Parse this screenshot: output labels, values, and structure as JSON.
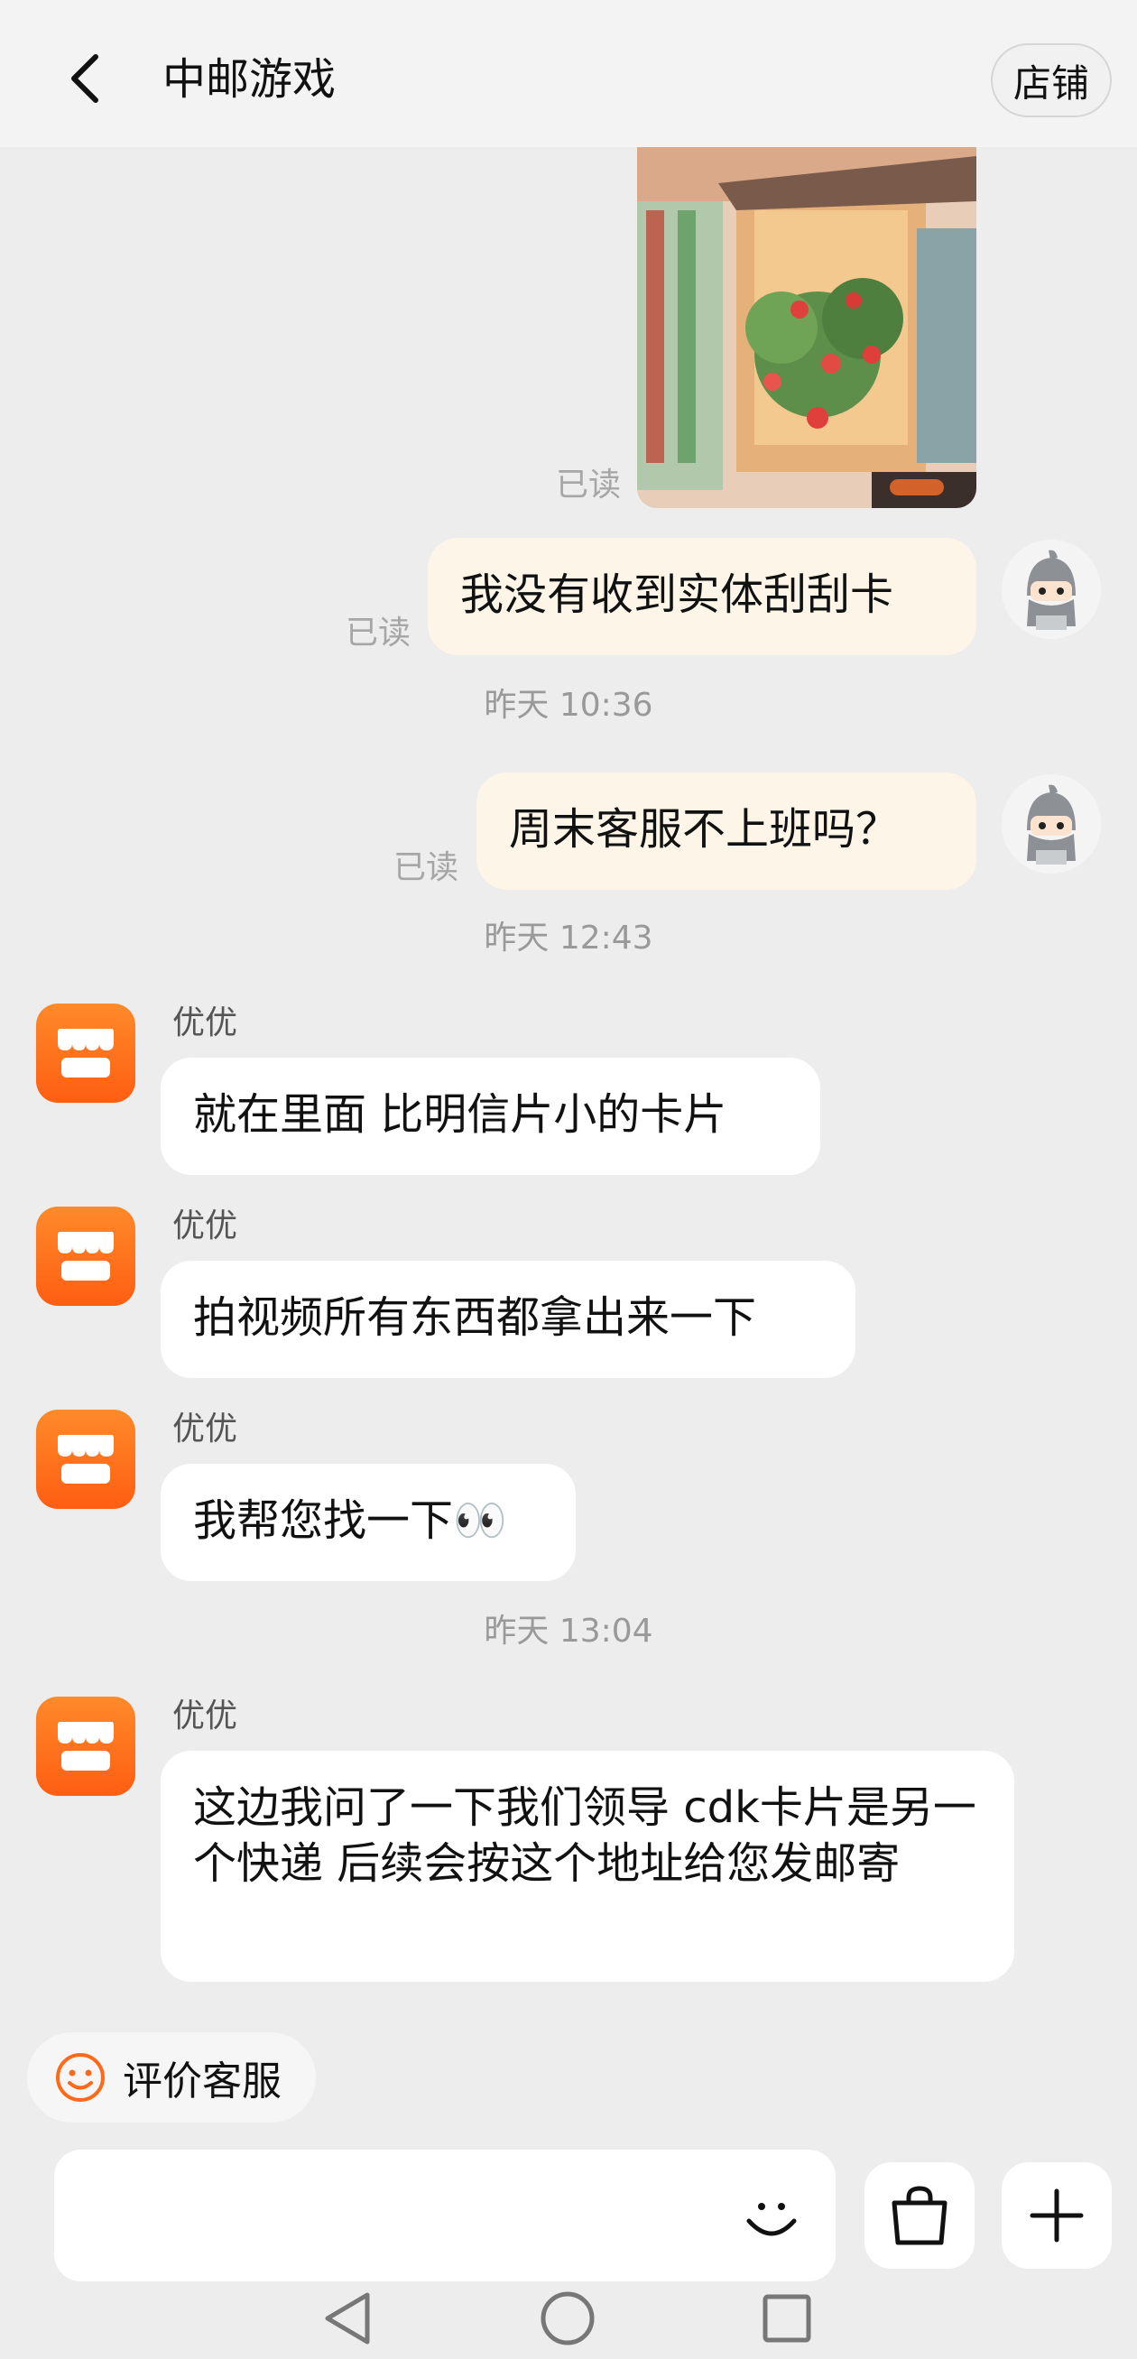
{
  "header": {
    "title": "中邮游戏",
    "shop_label": "店铺"
  },
  "image_message": {
    "read_status": "已读"
  },
  "messages": [
    {
      "text": "我没有收到实体刮刮卡",
      "read_status": "已读"
    },
    {
      "text": "周末客服不上班吗？",
      "read_status": "已读"
    },
    {
      "sender": "优优",
      "text": "就在里面 比明信片小的卡片"
    },
    {
      "sender": "优优",
      "text": "拍视频所有东西都拿出来一下"
    },
    {
      "sender": "优优",
      "text": "我帮您找一下👀"
    },
    {
      "sender": "优优",
      "text": "这边我问了一下我们领导 cdk卡片是另一个快递 后续会按这个地址给您发邮寄"
    }
  ],
  "timestamps": [
    "昨天 10:36",
    "昨天 12:43",
    "昨天 13:04"
  ],
  "rate_button": {
    "label": "评价客服"
  },
  "input": {
    "placeholder": ""
  },
  "icons": {
    "back": "chevron-left-icon",
    "emoji": "smile-icon",
    "shop_bag": "shopping-bag-icon",
    "plus": "plus-icon",
    "bot_avatar": "store-icon",
    "user_avatar": "ninja-avatar"
  },
  "colors": {
    "accent_orange": "#ff6a1a",
    "background": "#ededed",
    "my_bubble": "#fdf6e8",
    "other_bubble": "#ffffff"
  }
}
